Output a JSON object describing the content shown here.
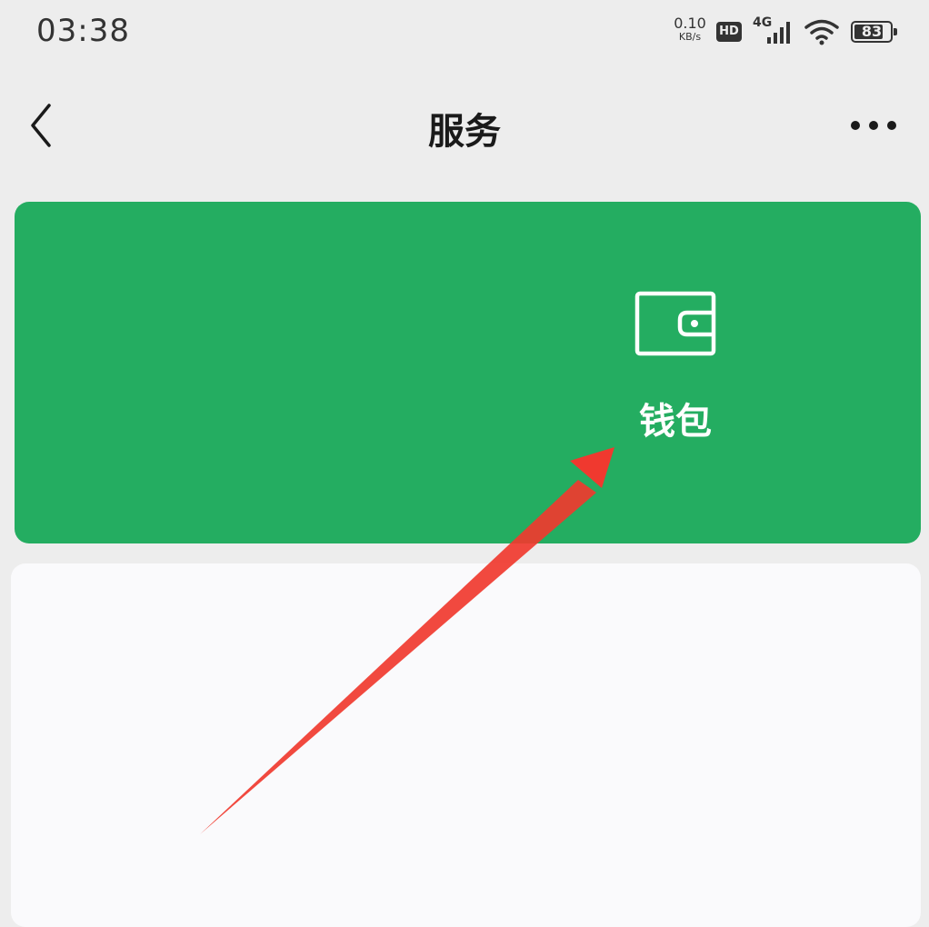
{
  "status_bar": {
    "time": "03:38",
    "net_speed_value": "0.10",
    "net_speed_unit": "KB/s",
    "hd_badge": "HD",
    "network_type": "4G",
    "battery_level": "83",
    "icons": [
      "hd-icon",
      "signal-icon",
      "wifi-icon",
      "battery-icon"
    ]
  },
  "nav": {
    "title": "服务",
    "back_icon": "chevron-left-icon",
    "more_icon": "more-dots-icon"
  },
  "wallet_card": {
    "label": "钱包",
    "icon": "wallet-icon",
    "background_color": "#24ad61",
    "text_color": "#ffffff"
  },
  "annotation": {
    "type": "arrow",
    "color": "#f0392f",
    "points_to": "wallet-label"
  },
  "colors": {
    "page_background": "#ededed",
    "panel_background": "#fafafc"
  }
}
